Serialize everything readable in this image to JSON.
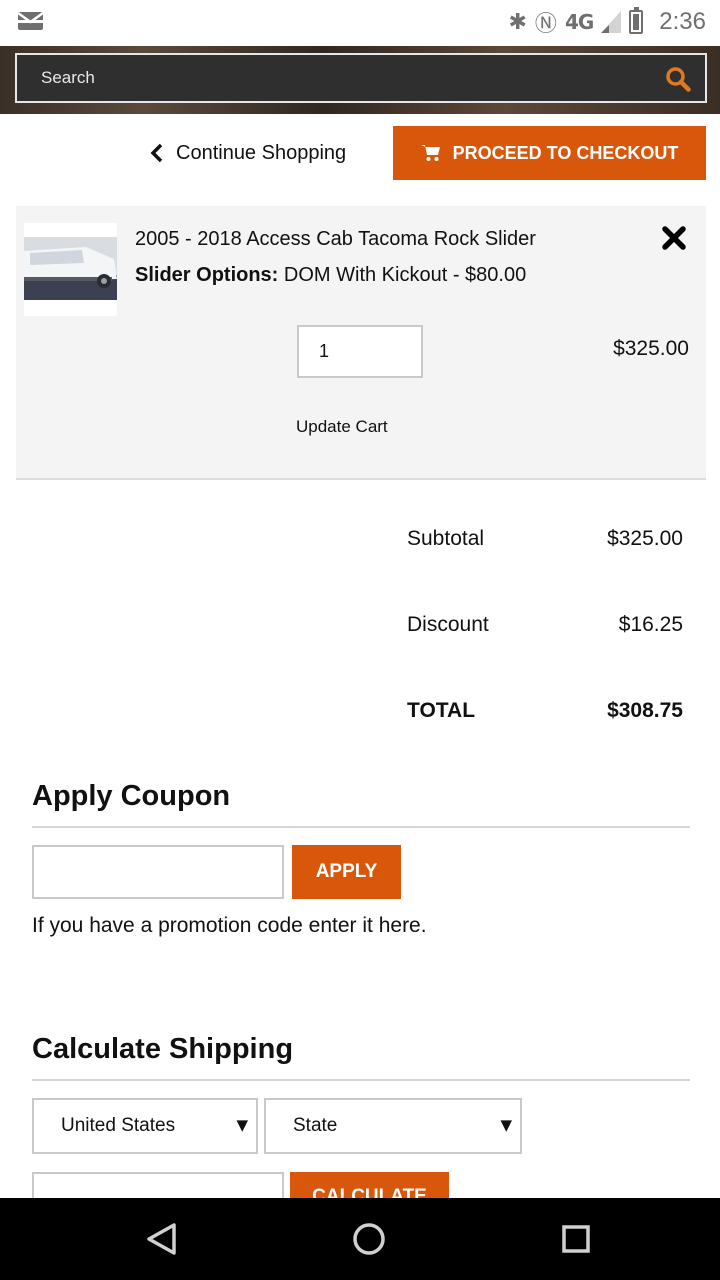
{
  "status_bar": {
    "time": "2:36",
    "network": "4G",
    "icons": [
      "mail-icon",
      "bluetooth-icon",
      "nfc-icon",
      "lte-icon",
      "signal-icon",
      "battery-icon"
    ]
  },
  "search": {
    "placeholder": "Search"
  },
  "actions": {
    "continue_label": "Continue Shopping",
    "checkout_label": "PROCEED TO CHECKOUT"
  },
  "cart": {
    "item": {
      "name": "2005 - 2018 Access Cab Tacoma Rock Slider",
      "option_label": "Slider Options:",
      "option_value": "DOM With Kickout - $80.00",
      "quantity": "1",
      "price": "$325.00",
      "update_label": "Update Cart"
    }
  },
  "totals": {
    "subtotal_label": "Subtotal",
    "subtotal_value": "$325.00",
    "discount_label": "Discount",
    "discount_value": "$16.25",
    "total_label": "TOTAL",
    "total_value": "$308.75"
  },
  "coupon": {
    "title": "Apply Coupon",
    "value": "",
    "apply_label": "APPLY",
    "hint": "If you have a promotion code enter it here."
  },
  "shipping": {
    "title": "Calculate Shipping",
    "country": "United States",
    "state": "State",
    "postcode": "",
    "calculate_label": "CALCULATE"
  },
  "colors": {
    "accent": "#d9570b",
    "panel": "#f4f4f4",
    "navbar": "#000000"
  }
}
